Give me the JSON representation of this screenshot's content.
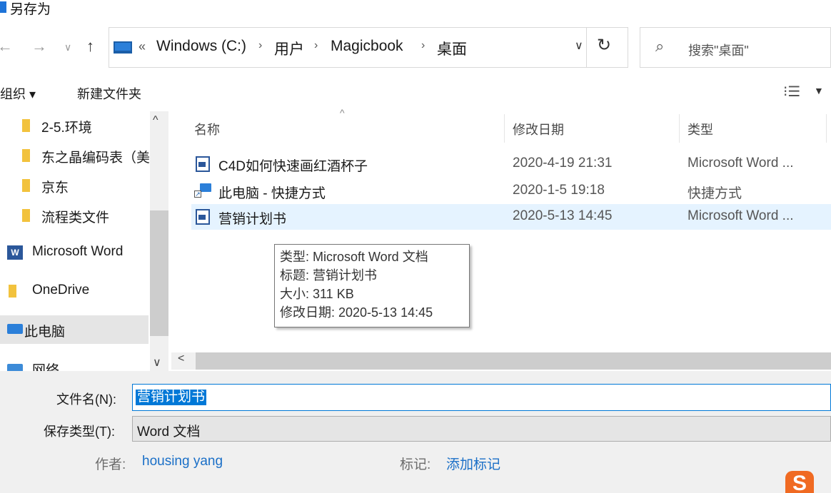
{
  "window": {
    "title": "另存为"
  },
  "address": {
    "overflow": "«",
    "crumbs": [
      "Windows (C:)",
      "用户",
      "Magicbook",
      "桌面"
    ],
    "separator": "›"
  },
  "search": {
    "placeholder": "搜索\"桌面\""
  },
  "toolbar": {
    "organize": "组织 ▾",
    "new_folder": "新建文件夹"
  },
  "nav_pane": {
    "items": [
      {
        "label": "2-5.环境",
        "icon": "folder-icon"
      },
      {
        "label": "东之晶编码表（美",
        "icon": "folder-icon"
      },
      {
        "label": "京东",
        "icon": "folder-icon"
      },
      {
        "label": "流程类文件",
        "icon": "folder-icon"
      },
      {
        "label": "Microsoft Word",
        "icon": "word-icon"
      },
      {
        "label": "OneDrive",
        "icon": "folder-icon"
      },
      {
        "label": "此电脑",
        "icon": "computer-icon"
      },
      {
        "label": "网络",
        "icon": "network-icon"
      }
    ]
  },
  "file_list": {
    "columns": [
      "名称",
      "修改日期",
      "类型"
    ],
    "rows": [
      {
        "name": "C4D如何快速画红酒杯子",
        "date": "2020-4-19 21:31",
        "type": "Microsoft Word ...",
        "icon": "word-doc-icon"
      },
      {
        "name": "此电脑 - 快捷方式",
        "date": "2020-1-5 19:18",
        "type": "快捷方式",
        "icon": "shortcut-icon"
      },
      {
        "name": "营销计划书",
        "date": "2020-5-13 14:45",
        "type": "Microsoft Word ...",
        "icon": "word-doc-icon"
      }
    ]
  },
  "tooltip": {
    "type": "类型: Microsoft Word 文档",
    "title": "标题: 营销计划书",
    "size": "大小: 311 KB",
    "modified": "修改日期: 2020-5-13 14:45"
  },
  "form": {
    "filename_label": "文件名(N):",
    "filename_value": "营销计划书",
    "savetype_label": "保存类型(T):",
    "savetype_value": "Word 文档",
    "author_label": "作者:",
    "author_value": "housing yang",
    "tags_label": "标记:",
    "tags_value": "添加标记"
  },
  "colors": {
    "accent": "#0078d7",
    "selection": "#e5f3ff",
    "folder": "#f2c23d",
    "link": "#1a6fc7"
  }
}
